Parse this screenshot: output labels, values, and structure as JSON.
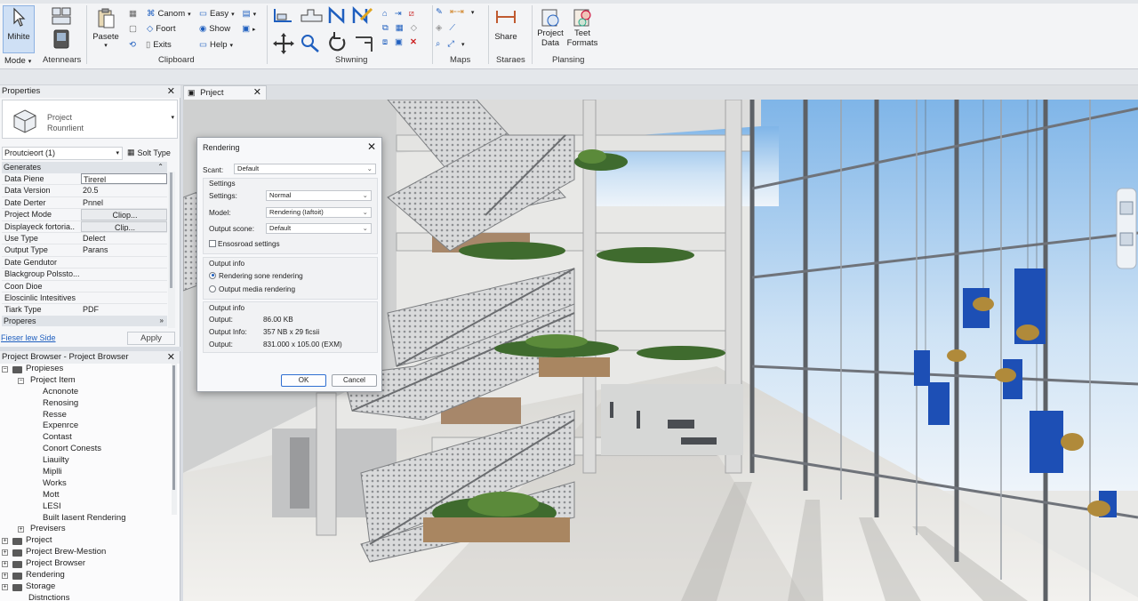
{
  "ribbon": {
    "mode_button": "Mihite",
    "mode_label": "Mode",
    "atennears_label": "Atennears",
    "paste_label": "Pasete",
    "clipboard_items": [
      "Canom",
      "Foort",
      "Exits"
    ],
    "clipboard_items2": [
      "Easy",
      "Show",
      "Help"
    ],
    "panels": {
      "clipboard": "Clipboard",
      "shwning": "Shwning",
      "maps": "Maps",
      "staraes": "Staraes",
      "planning": "Plansing"
    },
    "share_label": "Share",
    "project_data_label": "Project\nData",
    "teet_formats_label": "Teet\nFormats"
  },
  "properties": {
    "header": "Properties",
    "type_name": "Project\nRounrlient",
    "instance_selector": "Proutcieort (1)",
    "edit_type_label": "Solt Type",
    "cat_generates": "Generates",
    "rows": [
      {
        "k": "Data Piene",
        "v": "Tirerel"
      },
      {
        "k": "Data Version",
        "v": "20.5"
      },
      {
        "k": "Date Derter",
        "v": "Pnnel"
      },
      {
        "k": "Project Mode",
        "v": "Cliop..."
      },
      {
        "k": "Displayeck fortoria..",
        "v": "Clip..."
      },
      {
        "k": "Use Type",
        "v": "Delect"
      },
      {
        "k": "Output Type",
        "v": "Parans"
      },
      {
        "k": "Date Gendutor",
        "v": ""
      },
      {
        "k": "Blackgroup Polssto...",
        "v": ""
      },
      {
        "k": "Coon Dioe",
        "v": ""
      },
      {
        "k": "Eloscinlic Intesitives",
        "v": ""
      },
      {
        "k": "Tiark Type",
        "v": "PDF"
      }
    ],
    "cat_properes": "Properes",
    "help_link": "Fieser lew Side",
    "apply_button": "Apply"
  },
  "browser": {
    "header": "Project Browser - Project Browser",
    "root": "Propieses",
    "item_group": "Project Item",
    "items": [
      "Acnonote",
      "Renosing",
      "Resse",
      "Expenrce",
      "Contast",
      "Conort Conests",
      "Liauilty",
      "Miplli",
      "Works",
      "Mott",
      "LESI",
      "Built Iasent Rendering"
    ],
    "previsers": "Previsers",
    "top_nodes": [
      "Project",
      "Project Brew-Mestion",
      "Project Browser",
      "Rendering",
      "Storage"
    ],
    "last": "Distnctions"
  },
  "view_tab": {
    "label": "Pnject"
  },
  "dialog": {
    "title": "Rendering",
    "scant_label": "Scant:",
    "scant_value": "Default",
    "settings_header": "Settings",
    "settings_label": "Settings:",
    "settings_value": "Normal",
    "model_label": "Model:",
    "model_value": "Rendering (Iaftoit)",
    "output_scone_label": "Output scone:",
    "output_scone_value": "Default",
    "ensosroad_label": "Ensosroad settings",
    "output_info_header": "Output info",
    "radio_sone": "Rendering sone rendering",
    "radio_media": "Output media rendering",
    "output_info_header2": "Output info",
    "output_label": "Output:",
    "output_value": "86.00 KB",
    "output_info_label": "Output Info:",
    "output_info_value": "357 NB x 29 ficsii",
    "output2_label": "Output:",
    "output2_value": "831.000 x 105.00 (EXM)",
    "ok_button": "OK",
    "cancel_button": "Cancel"
  },
  "colors": {
    "accent": "#1f5fbf",
    "ribbon_bg": "#f3f4f6",
    "active_button": "#cfe0f5"
  }
}
